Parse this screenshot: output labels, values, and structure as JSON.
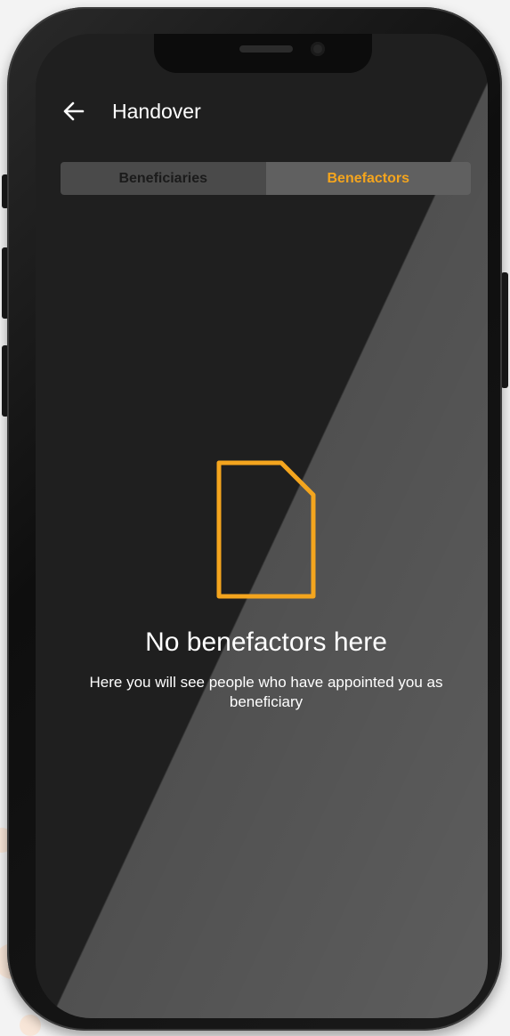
{
  "header": {
    "back_icon": "arrow-left-icon",
    "title": "Handover"
  },
  "tabs": [
    {
      "label": "Beneficiaries",
      "active": false
    },
    {
      "label": "Benefactors",
      "active": true
    }
  ],
  "empty_state": {
    "icon": "document-outline-icon",
    "title": "No benefactors here",
    "description": "Here you will see people who have appointed you as beneficiary"
  },
  "colors": {
    "accent": "#f4a51e",
    "screen_background": "#1f1f1f",
    "tab_background": "#4a4a4a",
    "text_primary": "#ffffff"
  }
}
